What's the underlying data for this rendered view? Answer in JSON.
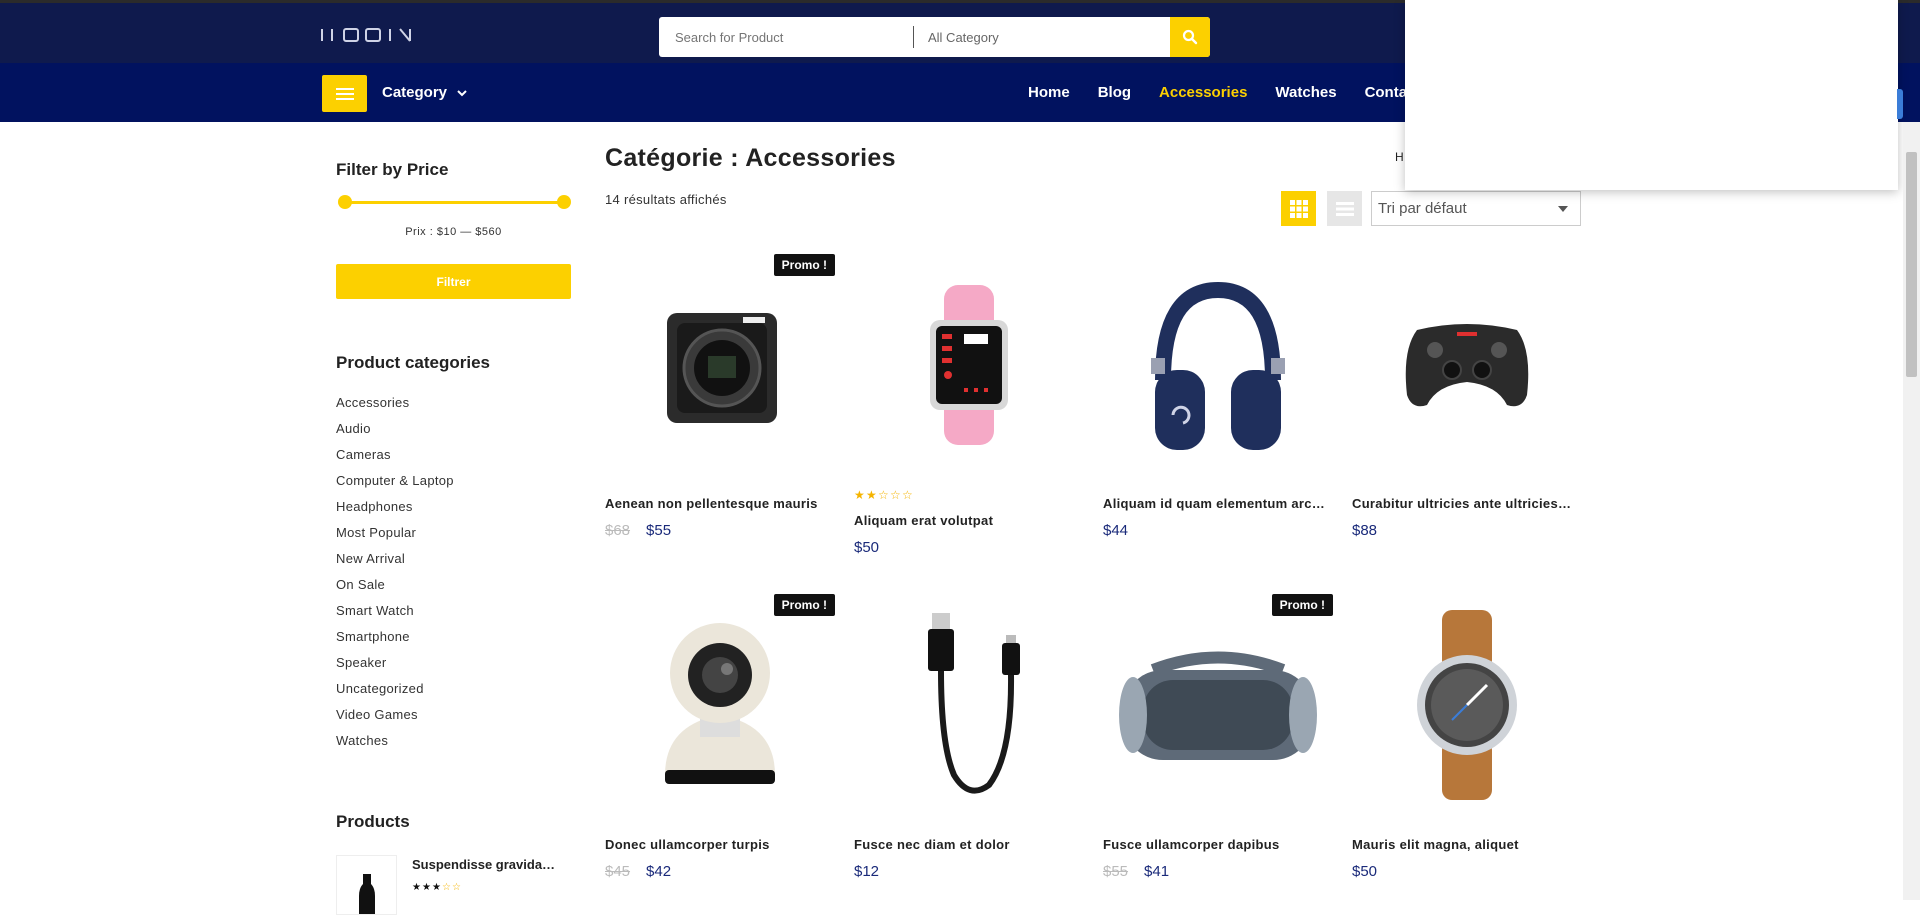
{
  "header": {
    "search_placeholder": "Search for Product",
    "category_select": "All Category"
  },
  "nav": {
    "category_label": "Category",
    "menu": [
      {
        "label": "Home"
      },
      {
        "label": "Blog"
      },
      {
        "label": "Accessories"
      },
      {
        "label": "Watches"
      },
      {
        "label": "Contac"
      }
    ]
  },
  "sidebar": {
    "filter_title": "Filter by Price",
    "price_label": "Prix : $10 — $560",
    "filter_button": "Filtrer",
    "categories_title": "Product categories",
    "categories": [
      "Accessories",
      "Audio",
      "Cameras",
      "Computer & Laptop",
      "Headphones",
      "Most Popular",
      "New Arrival",
      "On Sale",
      "Smart Watch",
      "Smartphone",
      "Speaker",
      "Uncategorized",
      "Video Games",
      "Watches"
    ],
    "products_title": "Products",
    "product": {
      "name": "Suspendisse gravida…",
      "rating": 3
    }
  },
  "main": {
    "title": "Catégorie : Accessories",
    "results": "14 résultats affichés",
    "breadcrumb_fragment": "H",
    "sort": "Tri par défaut"
  },
  "products": [
    {
      "title": "Aenean non pellentesque mauris",
      "old_price": "$68",
      "price": "$55",
      "badge": "Promo !",
      "rating": null
    },
    {
      "title": "Aliquam erat volutpat",
      "old_price": "",
      "price": "$50",
      "badge": "",
      "rating": 2
    },
    {
      "title": "Aliquam id quam elementum arc…",
      "old_price": "",
      "price": "$44",
      "badge": "",
      "rating": null
    },
    {
      "title": "Curabitur ultricies ante ultricies…",
      "old_price": "",
      "price": "$88",
      "badge": "",
      "rating": null
    },
    {
      "title": "Donec ullamcorper turpis",
      "old_price": "$45",
      "price": "$42",
      "badge": "Promo !",
      "rating": null
    },
    {
      "title": "Fusce nec diam et dolor",
      "old_price": "",
      "price": "$12",
      "badge": "",
      "rating": null
    },
    {
      "title": "Fusce ullamcorper dapibus",
      "old_price": "$55",
      "price": "$41",
      "badge": "Promo !",
      "rating": null
    },
    {
      "title": "Mauris elit magna, aliquet",
      "old_price": "",
      "price": "$50",
      "badge": "",
      "rating": null
    }
  ]
}
